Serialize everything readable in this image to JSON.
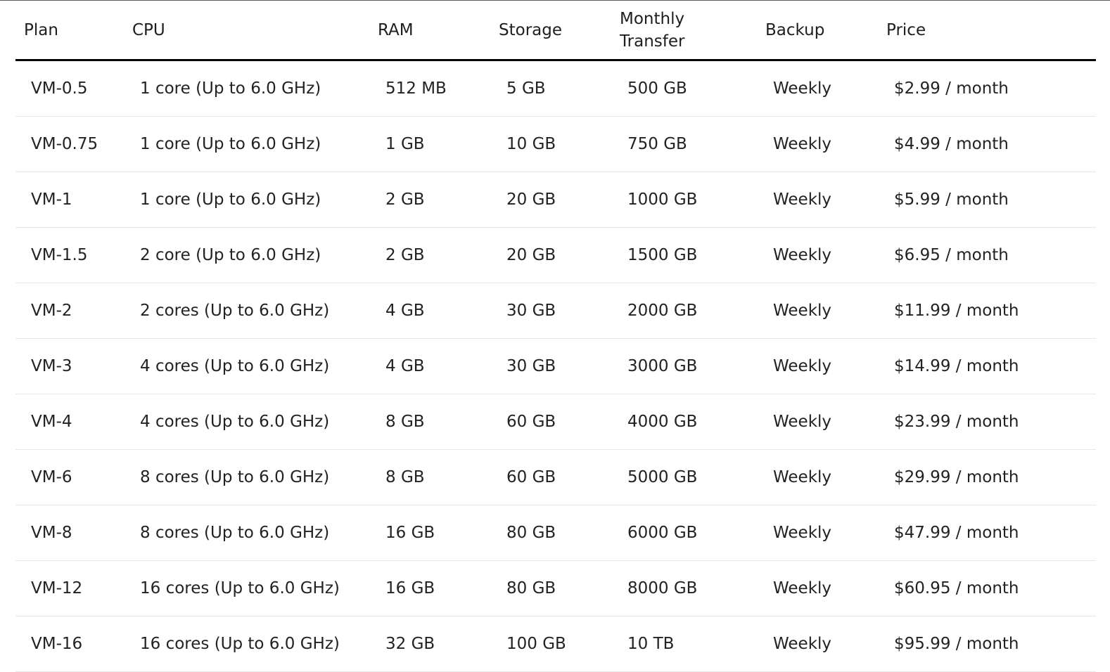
{
  "headers": {
    "plan": "Plan",
    "cpu": "CPU",
    "ram": "RAM",
    "storage": "Storage",
    "transfer_line1": "Monthly",
    "transfer_line2": "Transfer",
    "backup": "Backup",
    "price": "Price"
  },
  "rows": [
    {
      "plan": "VM-0.5",
      "cpu": "1 core (Up to 6.0 GHz)",
      "ram": "512 MB",
      "storage": "5 GB",
      "transfer": "500 GB",
      "backup": "Weekly",
      "price": "$2.99 / month"
    },
    {
      "plan": "VM-0.75",
      "cpu": "1 core (Up to 6.0 GHz)",
      "ram": "1 GB",
      "storage": "10 GB",
      "transfer": "750 GB",
      "backup": "Weekly",
      "price": "$4.99 / month"
    },
    {
      "plan": "VM-1",
      "cpu": "1 core (Up to 6.0 GHz)",
      "ram": "2 GB",
      "storage": "20 GB",
      "transfer": "1000 GB",
      "backup": "Weekly",
      "price": "$5.99 / month"
    },
    {
      "plan": "VM-1.5",
      "cpu": "2 core (Up to 6.0 GHz)",
      "ram": "2 GB",
      "storage": "20 GB",
      "transfer": "1500 GB",
      "backup": "Weekly",
      "price": "$6.95 / month"
    },
    {
      "plan": "VM-2",
      "cpu": "2 cores (Up to 6.0 GHz)",
      "ram": "4 GB",
      "storage": "30 GB",
      "transfer": "2000 GB",
      "backup": "Weekly",
      "price": "$11.99 / month"
    },
    {
      "plan": "VM-3",
      "cpu": "4 cores (Up to 6.0 GHz)",
      "ram": "4 GB",
      "storage": "30 GB",
      "transfer": "3000 GB",
      "backup": "Weekly",
      "price": "$14.99 / month"
    },
    {
      "plan": "VM-4",
      "cpu": "4 cores (Up to 6.0 GHz)",
      "ram": "8 GB",
      "storage": "60 GB",
      "transfer": "4000 GB",
      "backup": "Weekly",
      "price": "$23.99 / month"
    },
    {
      "plan": "VM-6",
      "cpu": "8 cores (Up to 6.0 GHz)",
      "ram": "8 GB",
      "storage": "60 GB",
      "transfer": "5000 GB",
      "backup": "Weekly",
      "price": "$29.99 / month"
    },
    {
      "plan": "VM-8",
      "cpu": "8 cores (Up to 6.0 GHz)",
      "ram": "16 GB",
      "storage": "80 GB",
      "transfer": "6000 GB",
      "backup": "Weekly",
      "price": "$47.99 / month"
    },
    {
      "plan": "VM-12",
      "cpu": "16 cores (Up to 6.0 GHz)",
      "ram": "16 GB",
      "storage": "80 GB",
      "transfer": "8000 GB",
      "backup": "Weekly",
      "price": "$60.95 / month"
    },
    {
      "plan": "VM-16",
      "cpu": "16 cores (Up to 6.0 GHz)",
      "ram": "32 GB",
      "storage": "100 GB",
      "transfer": "10 TB",
      "backup": "Weekly",
      "price": "$95.99 / month"
    }
  ]
}
